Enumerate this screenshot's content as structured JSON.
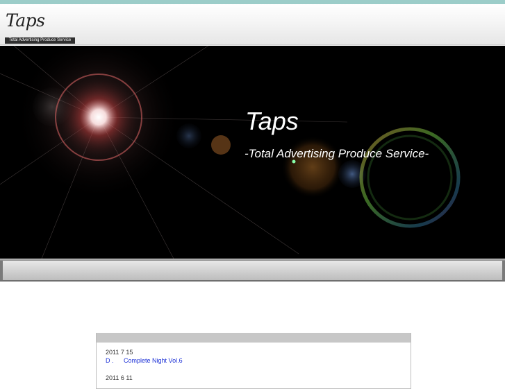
{
  "header": {
    "logo": "Taps",
    "tagline": "Total Advertising Produce Service"
  },
  "hero": {
    "title": "Taps",
    "subtitle": "-Total Advertising Produce Service-"
  },
  "news": {
    "items": [
      {
        "date": "2011 7 15",
        "link_label": "D .",
        "link_title": "Complete Night Vol.6"
      },
      {
        "date": "2011 6 11"
      }
    ]
  },
  "colors": {
    "top_accent": "#9ccdc9",
    "link": "#1a2fd6"
  }
}
